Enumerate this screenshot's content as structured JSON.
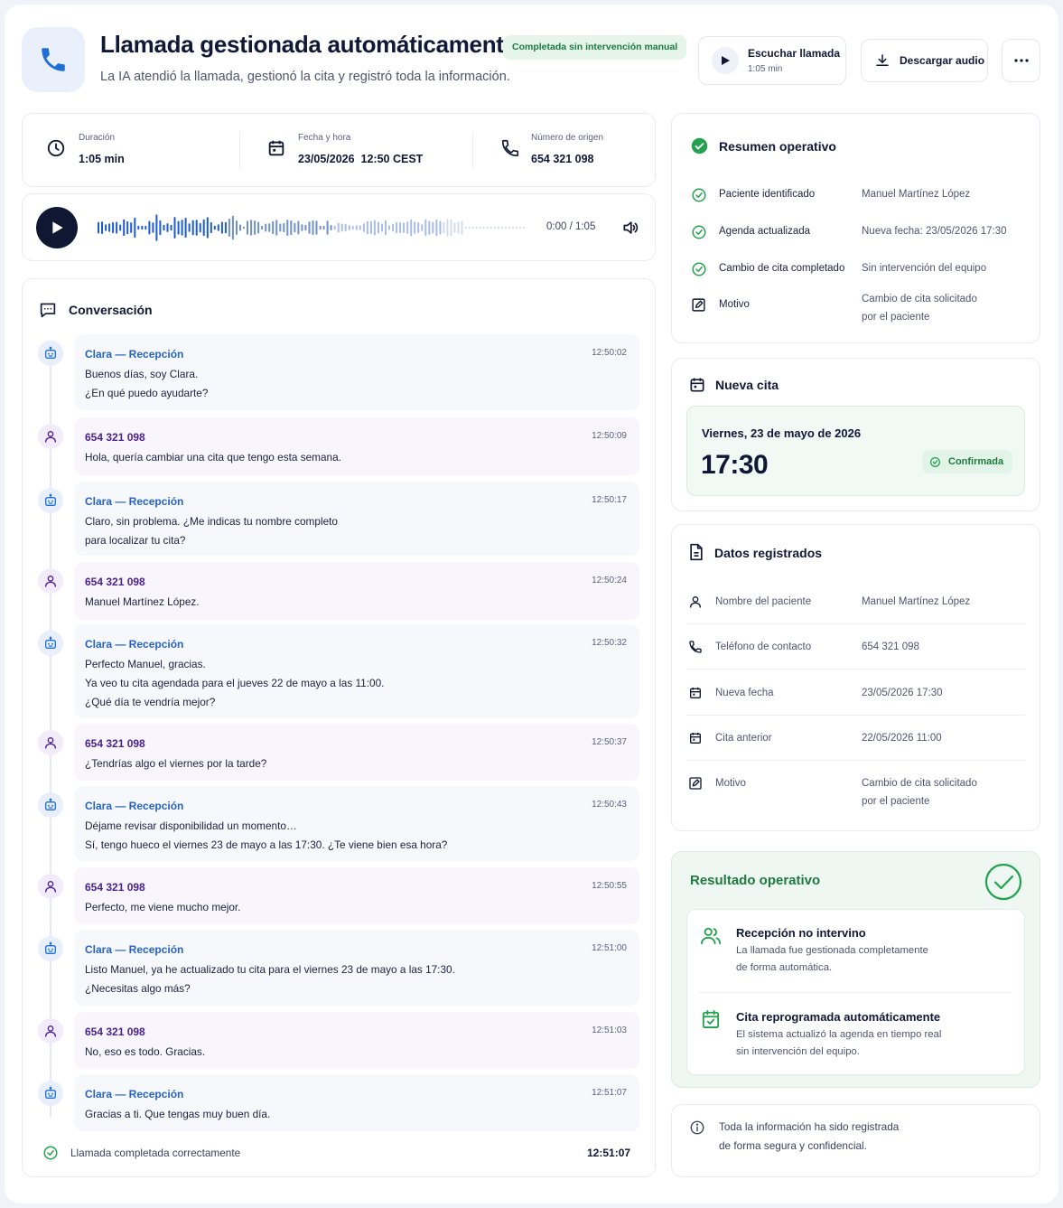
{
  "header": {
    "title": "Llamada gestionada automáticamente",
    "badge": "Completada sin intervención manual",
    "subtitle": "La IA atendió la llamada, gestionó la cita y registró toda la información.",
    "listen_label": "Escuchar llamada",
    "listen_duration": "1:05 min",
    "download_label": "Descargar audio"
  },
  "info": {
    "duration_label": "Duración",
    "duration_value": "1:05 min",
    "datetime_label": "Fecha y hora",
    "datetime_value": "23/05/2026  12:50 CEST",
    "origin_label": "Número de origen",
    "origin_value": "654 321 098"
  },
  "player": {
    "time": "0:00 / 1:05",
    "progress": 0
  },
  "conversation": {
    "title": "Conversación",
    "bot_name": "Clara — Recepción",
    "caller": "654 321 098",
    "messages": [
      {
        "role": "bot",
        "time": "12:50:02",
        "lines": [
          "Buenos días, soy Clara.",
          "¿En qué puedo ayudarte?"
        ]
      },
      {
        "role": "user",
        "time": "12:50:09",
        "lines": [
          "Hola, quería cambiar una cita que tengo esta semana."
        ]
      },
      {
        "role": "bot",
        "time": "12:50:17",
        "lines": [
          "Claro, sin problema. ¿Me indicas tu nombre completo",
          "para localizar tu cita?"
        ]
      },
      {
        "role": "user",
        "time": "12:50:24",
        "lines": [
          "Manuel Martínez López."
        ]
      },
      {
        "role": "bot",
        "time": "12:50:32",
        "lines": [
          "Perfecto Manuel, gracias.",
          "Ya veo tu cita agendada para el jueves 22 de mayo a las 11:00.",
          "¿Qué día te vendría mejor?"
        ]
      },
      {
        "role": "user",
        "time": "12:50:37",
        "lines": [
          "¿Tendrías algo el viernes por la tarde?"
        ]
      },
      {
        "role": "bot",
        "time": "12:50:43",
        "lines": [
          "Déjame revisar disponibilidad un momento…",
          "Sí, tengo hueco el viernes 23 de mayo a las 17:30. ¿Te viene bien esa hora?"
        ]
      },
      {
        "role": "user",
        "time": "12:50:55",
        "lines": [
          "Perfecto, me viene mucho mejor."
        ]
      },
      {
        "role": "bot",
        "time": "12:51:00",
        "lines": [
          "Listo Manuel, ya he actualizado tu cita para el viernes 23 de mayo a las 17:30.",
          "¿Necesitas algo más?"
        ]
      },
      {
        "role": "user",
        "time": "12:51:03",
        "lines": [
          "No, eso es todo. Gracias."
        ]
      },
      {
        "role": "bot",
        "time": "12:51:07",
        "lines": [
          "Gracias a ti. Que tengas muy buen día."
        ]
      }
    ],
    "footer_text": "Llamada completada correctamente",
    "footer_time": "12:51:07"
  },
  "summary": {
    "title": "Resumen operativo",
    "rows": [
      {
        "label": "Paciente identificado",
        "value": [
          "Manuel Martínez López"
        ]
      },
      {
        "label": "Agenda actualizada",
        "value": [
          "Nueva fecha: 23/05/2026 17:30"
        ]
      },
      {
        "label": "Cambio de cita completado",
        "value": [
          "Sin intervención del equipo"
        ]
      },
      {
        "label": "Motivo",
        "value": [
          "Cambio de cita solicitado",
          "por el paciente"
        ]
      }
    ]
  },
  "new_appointment": {
    "title": "Nueva cita",
    "date": "Viernes, 23 de mayo de 2026",
    "time": "17:30",
    "status": "Confirmada"
  },
  "registered": {
    "title": "Datos registrados",
    "rows": [
      {
        "label": "Nombre del paciente",
        "value": [
          "Manuel Martínez López"
        ]
      },
      {
        "label": "Teléfono de contacto",
        "value": [
          "654 321 098"
        ]
      },
      {
        "label": "Nueva fecha",
        "value": [
          "23/05/2026 17:30"
        ]
      },
      {
        "label": "Cita anterior",
        "value": [
          "22/05/2026 11:00"
        ]
      },
      {
        "label": "Motivo",
        "value": [
          "Cambio de cita solicitado",
          "por el paciente"
        ]
      }
    ]
  },
  "result": {
    "title": "Resultado operativo",
    "items": [
      {
        "title": "Recepción no intervino",
        "lines": [
          "La llamada fue gestionada completamente",
          "de forma automática."
        ]
      },
      {
        "title": "Cita reprogramada automáticamente",
        "lines": [
          "El sistema actualizó la agenda en tiempo real",
          "sin intervención del equipo."
        ]
      }
    ]
  },
  "note": {
    "lines": [
      "Toda la información ha sido registrada",
      "de forma segura y confidencial."
    ]
  },
  "colors": {
    "primary": "#1f6fd6",
    "success": "#22a24e",
    "purple": "#4b1f8e",
    "dark": "#0f1733"
  }
}
